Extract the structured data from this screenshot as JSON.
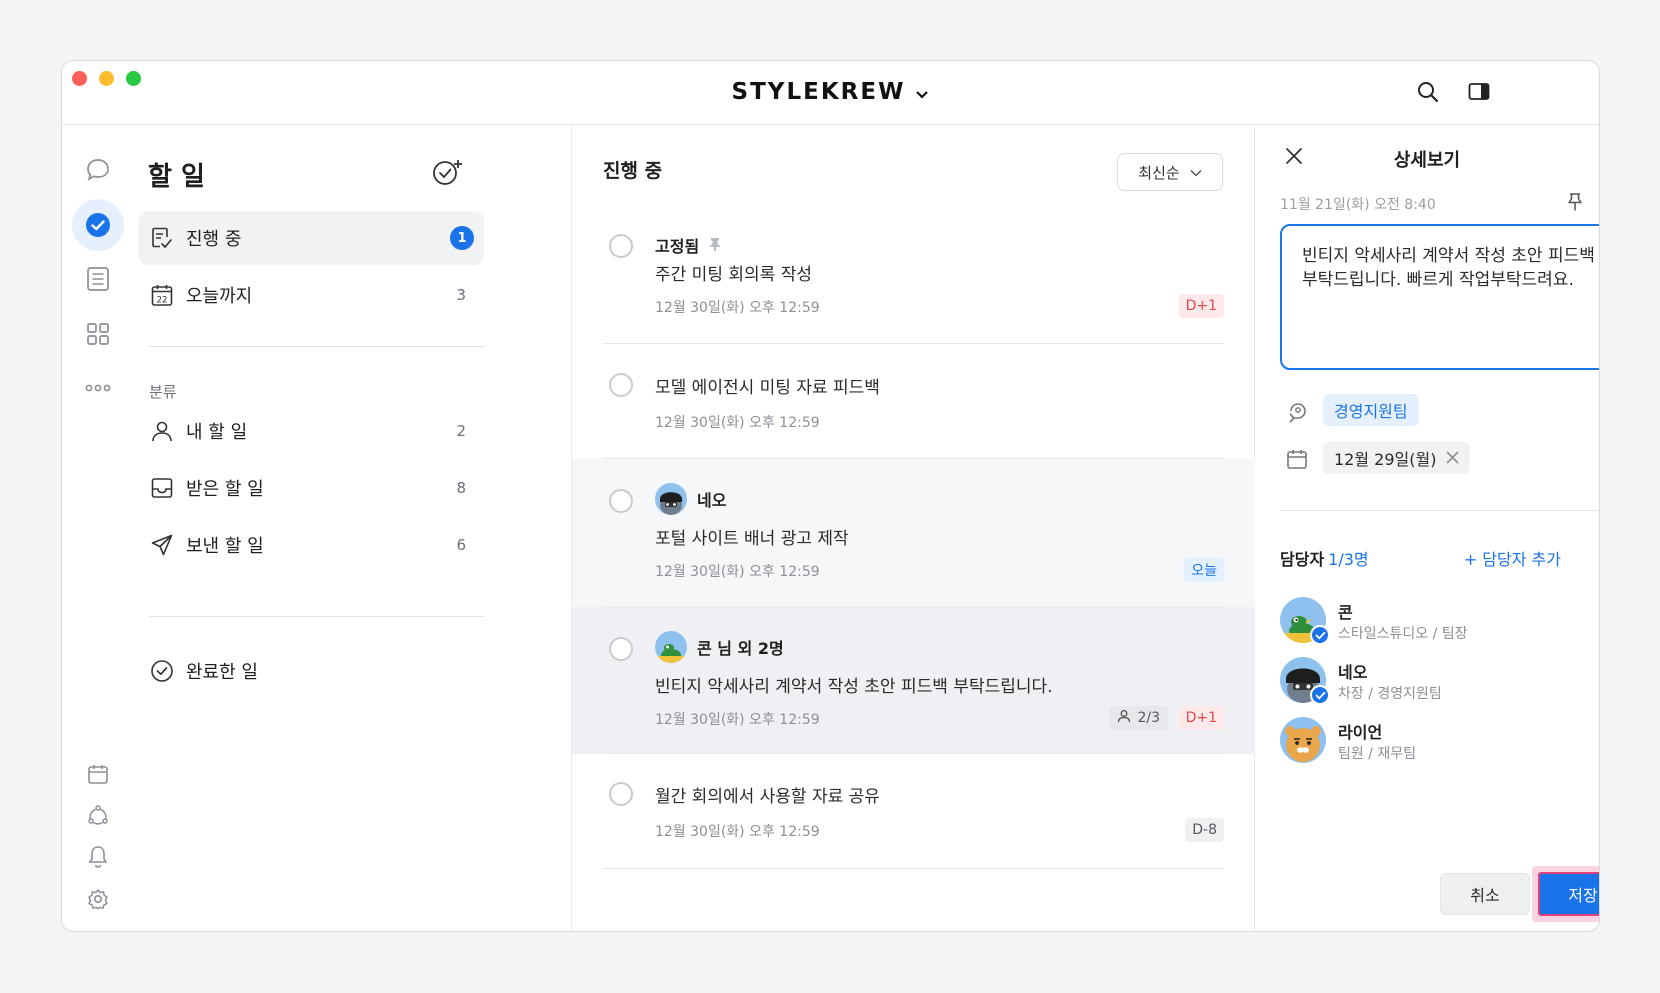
{
  "app": {
    "brand": "STYLEKREW"
  },
  "nav": {
    "title": "할 일",
    "items": [
      {
        "label": "진행 중",
        "count": "1",
        "active": true
      },
      {
        "label": "오늘까지",
        "count": "3"
      }
    ],
    "section_label": "분류",
    "categories": [
      {
        "label": "내 할 일",
        "count": "2"
      },
      {
        "label": "받은 할 일",
        "count": "8"
      },
      {
        "label": "보낸 할 일",
        "count": "6"
      }
    ],
    "completed_label": "완료한 일"
  },
  "list": {
    "title": "진행 중",
    "sort_label": "최신순",
    "tasks": [
      {
        "head": "고정됨",
        "title": "주간 미팅 회의록 작성",
        "date": "12월 30일(화) 오후 12:59",
        "tag": "D+1"
      },
      {
        "title": "모델 에이전시 미팅 자료 피드백",
        "date": "12월 30일(화) 오후 12:59"
      },
      {
        "head": "네오",
        "title": "포털 사이트 배너 광고 제작",
        "date": "12월 30일(화) 오후 12:59",
        "tag": "오늘"
      },
      {
        "head": "콘 님 외 2명",
        "title": "빈티지 악세사리 계약서 작성 초안 피드백 부탁드립니다.",
        "date": "12월 30일(화) 오후 12:59",
        "progress": "2/3",
        "tag": "D+1"
      },
      {
        "title": "월간 회의에서 사용할 자료 공유",
        "date": "12월 30일(화) 오후 12:59",
        "tag": "D-8"
      }
    ]
  },
  "detail": {
    "title": "상세보기",
    "timestamp": "11월 21일(화) 오전 8:40",
    "body": "빈티지 악세사리 계약서 작성 초안 피드백 부탁드립니다. 빠르게 작업부탁드려요.",
    "team_chip": "경영지원팀",
    "due_chip": "12월 29일(월)",
    "assignee_label": "담당자",
    "assignee_count": "1/3명",
    "add_assignee": "+ 담당자 추가",
    "assignees": [
      {
        "name": "콘",
        "role": "스타일스튜디오 / 팀장"
      },
      {
        "name": "네오",
        "role": "차장 / 경영지원팀"
      },
      {
        "name": "라이언",
        "role": "팀원 / 재무팀"
      }
    ],
    "cancel_label": "취소",
    "save_label": "저장"
  },
  "colors": {
    "accent": "#1a73e8",
    "danger": "#e5484d"
  }
}
